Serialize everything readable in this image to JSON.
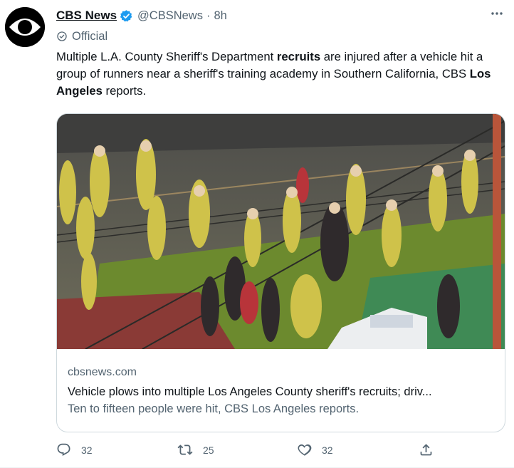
{
  "author": {
    "name": "CBS News",
    "handle": "@CBSNews",
    "separator": "·",
    "time": "8h",
    "label": "Official",
    "verified_color": "#1d9bf0"
  },
  "tweet": {
    "text_parts": [
      "Multiple L.A. County Sheriff's Department ",
      "recruits",
      " are injured after a vehicle hit a group of runners near a sheriff's training academy in Southern California, CBS ",
      "Los Angeles",
      " reports."
    ]
  },
  "card": {
    "domain": "cbsnews.com",
    "headline": "Vehicle plows into multiple Los Angeles County sheriff's recruits; driv...",
    "description": "Ten to fifteen people were hit, CBS Los Angeles reports."
  },
  "actions": {
    "replies": "32",
    "retweets": "25",
    "likes": "32"
  },
  "icons": {
    "more": "more-icon",
    "reply": "reply-icon",
    "retweet": "retweet-icon",
    "like": "heart-icon",
    "share": "share-icon"
  }
}
